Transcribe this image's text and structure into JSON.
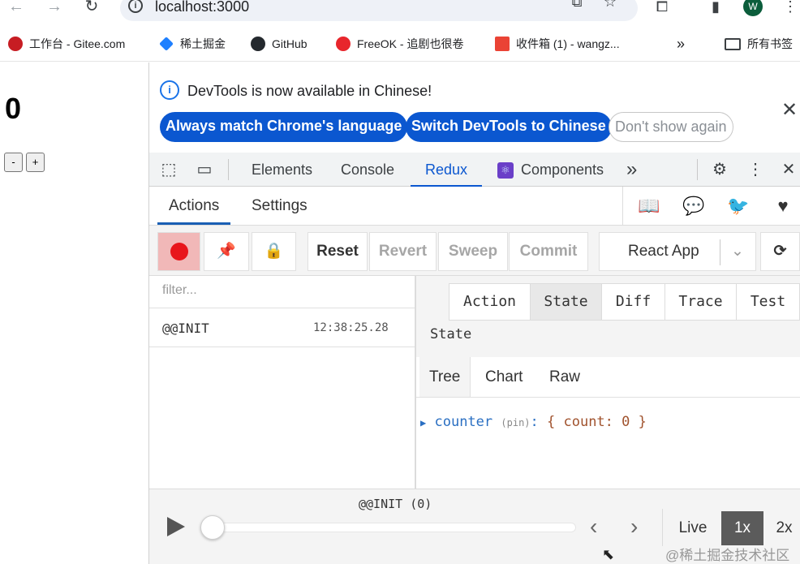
{
  "browser": {
    "url": "localhost:3000",
    "avatar_letter": "W",
    "bookmarks": [
      {
        "label": "工作台 - Gitee.com",
        "color": "#c71d23"
      },
      {
        "label": "稀土掘金",
        "color": "#1e80ff"
      },
      {
        "label": "GitHub",
        "color": "#24292e"
      },
      {
        "label": "FreeOK - 追剧也很卷",
        "color": "#e8262c"
      },
      {
        "label": "收件箱 (1) - wangz...",
        "color": "#ea4335"
      }
    ],
    "bookmarks_overflow": "»",
    "all_bookmarks_label": "所有书签"
  },
  "app": {
    "count": "0",
    "decrement_label": "-",
    "increment_label": "+"
  },
  "banner": {
    "message": "DevTools is now available in Chinese!",
    "btn_match": "Always match Chrome's language",
    "btn_switch": "Switch DevTools to Chinese",
    "btn_dont_show": "Don't show again"
  },
  "devtools": {
    "tabs": [
      "Elements",
      "Console",
      "Redux",
      "Components"
    ],
    "active_tab": "Redux",
    "overflow": "»"
  },
  "redux": {
    "tabs": [
      "Actions",
      "Settings"
    ],
    "toolbar": {
      "reset": "Reset",
      "revert": "Revert",
      "sweep": "Sweep",
      "commit": "Commit",
      "instance": "React App"
    },
    "filter_placeholder": "filter...",
    "actions": [
      {
        "name": "@@INIT",
        "time": "12:38:25.28"
      }
    ],
    "monitor_tabs": [
      "Action",
      "State",
      "Diff",
      "Trace",
      "Test"
    ],
    "monitor_active": "State",
    "panel_title": "State",
    "view_tabs": [
      "Tree",
      "Chart",
      "Raw"
    ],
    "tree": {
      "key": "counter",
      "pin": "(pin)",
      "colon": ":",
      "value": "{ count: 0 }"
    },
    "slider": {
      "label": "@@INIT (0)",
      "live": "Live",
      "speed_1x": "1x",
      "speed_2x": "2x"
    }
  },
  "watermark": "@稀土掘金技术社区",
  "colors": {
    "accent": "#0b57d0",
    "record": "#e8161c",
    "tree_key": "#2a6fc2",
    "tree_value": "#a0522d"
  }
}
